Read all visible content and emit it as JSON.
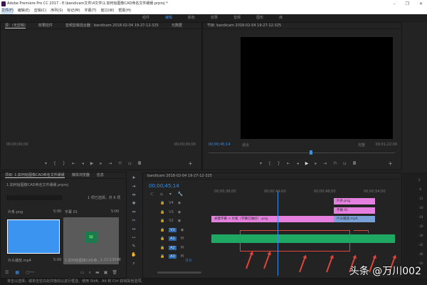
{
  "window": {
    "title": "Adobe Premiere Pro CC 2017 - E:\\bandicam文件\\4文件\\1.如何给图像CAD命名文件缓缓.prproj *",
    "min": "–",
    "max": "❐",
    "close": "✕"
  },
  "menu": [
    "文件(F)",
    "编辑(E)",
    "剪辑(C)",
    "序列(S)",
    "标记(M)",
    "字幕(T)",
    "窗口(W)",
    "帮助(H)"
  ],
  "workspaces": [
    "组件",
    "编辑",
    "颜色",
    "效果",
    "音频",
    "图形",
    "库"
  ],
  "workspace_active": 1,
  "source_panel": {
    "tabs": [
      "源：(无剪辑)",
      "效果控件",
      "音频剪辑混合器：bandicam 2018-02-04 19-27-12-325",
      "元数据"
    ],
    "tc_left": "00;00;00;00",
    "tc_right": "00;00;00;00"
  },
  "program_panel": {
    "title": "节目: bandicam 2018-02-04 19-27-12-325",
    "tc_current": "00;00;45;14",
    "fit": "适合",
    "quality": "完整",
    "tc_duration": "00;01;22;09",
    "playhead": 0.55
  },
  "project_panel": {
    "tabs": [
      "项目: 1.如何给图像CAD命名文件缓缓",
      "媒体浏览器",
      "信息"
    ],
    "project_file": "1.如何给图像CAD命名文件缓缓.prproj",
    "selection": "1 项已选择，共 6 项",
    "items": [
      {
        "name": "片条.png",
        "duration": "5:00",
        "thumb": "#3b95f0",
        "caption": "片头播放.mp4",
        "caption_dur": "5:00"
      },
      {
        "name": "字幕 01",
        "duration": "5:00",
        "thumb": "#5a5a5a",
        "caption": "1.如何给图像CAD命...",
        "caption_dur": "1:22:13068"
      }
    ]
  },
  "timeline": {
    "title": "bandicam 2018-02-04 19-27-12-325",
    "timecode": "00;00;45;14",
    "ruler": [
      "00;00;38;00",
      "00;00;44;00",
      "00;00;48;00",
      "00;00;54;00"
    ],
    "playhead": 0.36,
    "tracks": [
      "V4",
      "V3",
      "V2",
      "V1",
      "A1",
      "A2",
      "A3"
    ],
    "clips": {
      "c1": "片条.png",
      "c2": "字幕 01",
      "c3": "片头播放.mp4",
      "long": "关键字幕 + 片尾（字幕已做好）.png"
    },
    "master": "0.0"
  },
  "meters": [
    "0",
    "-6",
    "-12",
    "-18",
    "-24",
    "-30",
    "-36",
    "-42",
    "-48",
    "-54"
  ],
  "status": "单击以选择，或单击空白处并拖动以进行框选。使用 Shift、Alt 和 Ctrl 获得其他选项。",
  "watermark": "头条 @万川002",
  "colors": {
    "accent": "#3d8ee0",
    "annotation": "#e0443a",
    "audio_clip": "#1fa863",
    "graphic_clip": "#e680e0"
  }
}
